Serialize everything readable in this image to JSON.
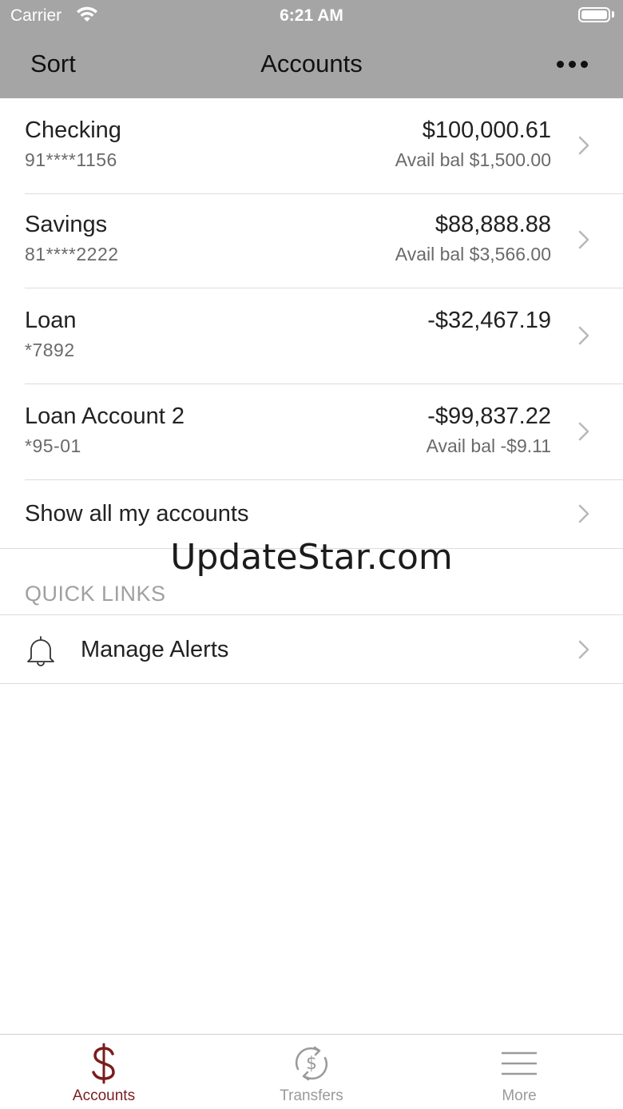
{
  "status_bar": {
    "carrier": "Carrier",
    "time": "6:21 AM"
  },
  "nav": {
    "left_label": "Sort",
    "title": "Accounts"
  },
  "accounts": [
    {
      "name": "Checking",
      "number": "91****1156",
      "balance": "$100,000.61",
      "avail": "Avail bal $1,500.00"
    },
    {
      "name": "Savings",
      "number": "81****2222",
      "balance": "$88,888.88",
      "avail": "Avail bal $3,566.00"
    },
    {
      "name": "Loan",
      "number": "*7892",
      "balance": "-$32,467.19",
      "avail": ""
    },
    {
      "name": "Loan Account 2",
      "number": "*95-01",
      "balance": "-$99,837.22",
      "avail": "Avail bal -$9.11"
    }
  ],
  "show_all": "Show all my accounts",
  "watermark": "UpdateStar.com",
  "quick_links": {
    "header": "QUICK LINKS",
    "items": [
      {
        "label": "Manage Alerts",
        "icon": "bell-icon"
      }
    ]
  },
  "tabs": [
    {
      "label": "Accounts",
      "icon": "dollar-icon",
      "active": true
    },
    {
      "label": "Transfers",
      "icon": "transfer-icon",
      "active": false
    },
    {
      "label": "More",
      "icon": "menu-icon",
      "active": false
    }
  ],
  "colors": {
    "nav_bg": "#a5a5a5",
    "accent": "#7a1d1d",
    "inactive": "#9a9a9a"
  }
}
